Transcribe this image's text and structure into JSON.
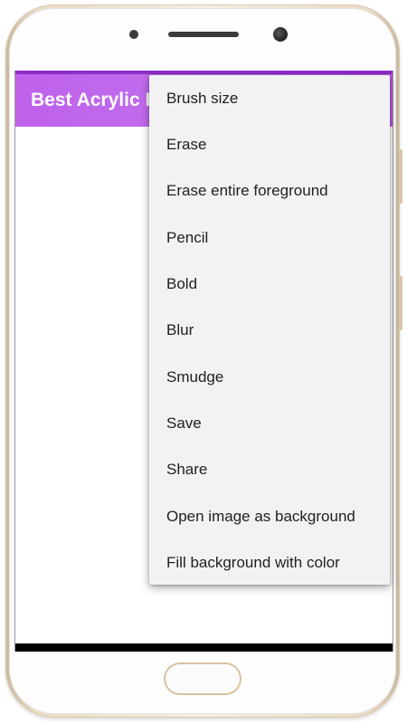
{
  "app": {
    "title": "Best Acrylic Painting"
  },
  "menu": {
    "items": [
      {
        "label": "Brush size"
      },
      {
        "label": "Erase"
      },
      {
        "label": "Erase entire foreground"
      },
      {
        "label": "Pencil"
      },
      {
        "label": "Bold"
      },
      {
        "label": "Blur"
      },
      {
        "label": "Smudge"
      },
      {
        "label": "Save"
      },
      {
        "label": "Share"
      },
      {
        "label": "Open image as background"
      },
      {
        "label": "Fill background with color"
      }
    ]
  },
  "colors": {
    "appbar": "#c070ee",
    "menu_background": "#f2f2f2",
    "phone_frame": "#e9dcc7"
  }
}
